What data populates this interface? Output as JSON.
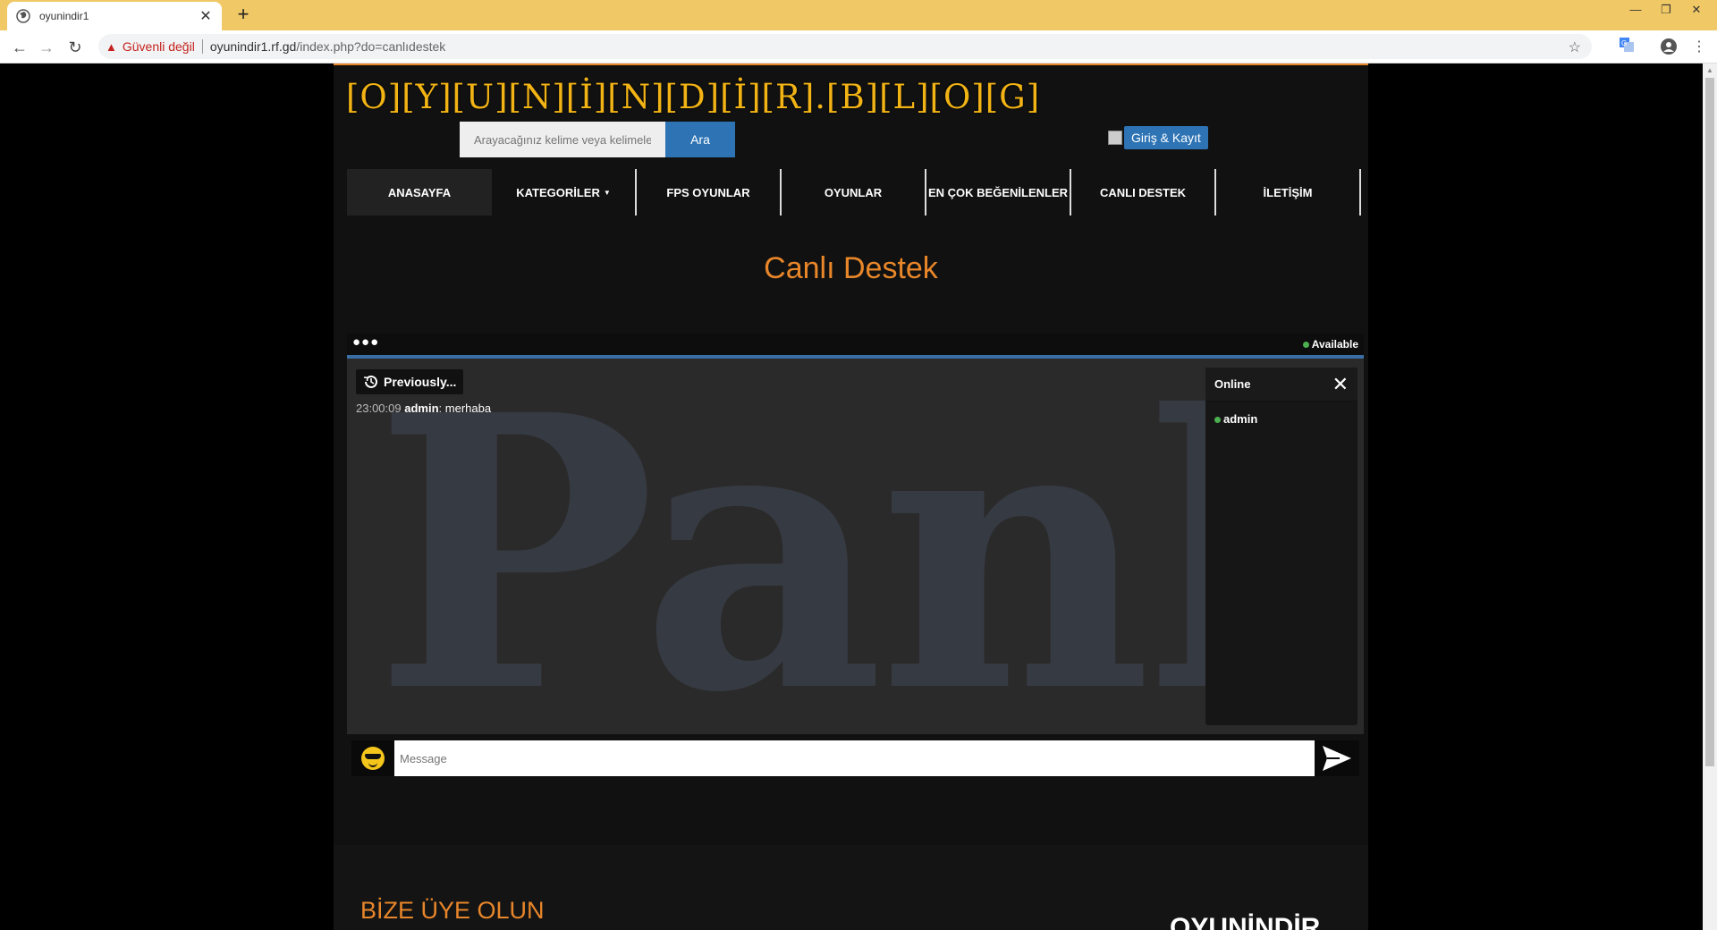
{
  "browser": {
    "tab_title": "oyunindir1",
    "tab_close": "✕",
    "new_tab": "+",
    "security_warning": "Güvenli değil",
    "url_host": "oyunindir1.rf.gd",
    "url_path": "/index.php?do=canlıdestek",
    "icons": [
      "back-arrow-icon",
      "forward-arrow-icon",
      "reload-icon",
      "warning-icon",
      "star-icon",
      "translate-icon",
      "profile-icon",
      "menu-kebab-icon"
    ]
  },
  "site": {
    "logo": "[O][Y][U][N][İ][N][D][İ][R].[B][L][O][G]",
    "search": {
      "placeholder": "Arayacağınız kelime veya kelimeler",
      "button": "Ara"
    },
    "login_button": "Giriş & Kayıt",
    "nav": [
      {
        "label": "ANASAYFA"
      },
      {
        "label": "KATEGORİLER"
      },
      {
        "label": "FPS OYUNLAR"
      },
      {
        "label": "OYUNLAR"
      },
      {
        "label": "EN ÇOK BEĞENİLENLER"
      },
      {
        "label": "CANLI DESTEK"
      },
      {
        "label": "İLETİŞİM"
      }
    ],
    "page_title": "Canlı Destek",
    "accent_color": "#e8862a",
    "logo_color": "#f2b315"
  },
  "chat": {
    "menu_dots": "●●●",
    "status": "Available",
    "watermark": "Panl",
    "previously_button": "Previously...",
    "messages": [
      {
        "time": "23:00:09",
        "user": "admin",
        "text": "merhaba"
      }
    ],
    "online_panel": {
      "title": "Online",
      "users": [
        "admin"
      ]
    },
    "input_placeholder": "Message",
    "status_color": "#4caf50",
    "bar_color": "#3a6ea5"
  },
  "footer": {
    "title": "BİZE ÜYE OLUN",
    "logo_partial": "OYUNİNDİR"
  }
}
